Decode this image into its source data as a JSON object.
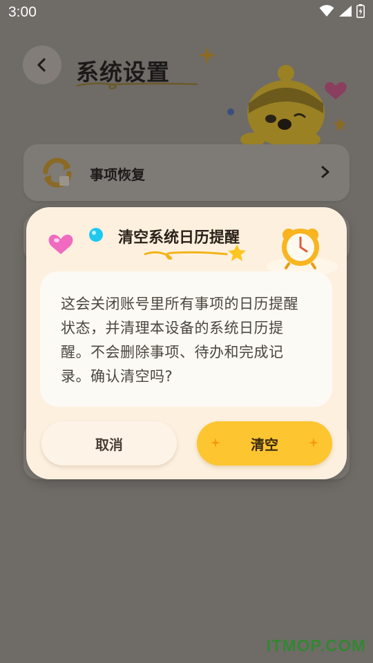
{
  "status_bar": {
    "time": "3:00"
  },
  "header": {
    "title": "系统设置"
  },
  "settings": {
    "items": [
      {
        "label": "事项恢复"
      }
    ]
  },
  "dialog": {
    "title": "清空系统日历提醒",
    "message": "这会关闭账号里所有事项的日历提醒状态，并清理本设备的系统日历提醒。不会删除事项、待办和完成记录。确认清空吗?",
    "cancel_label": "取消",
    "confirm_label": "清空"
  },
  "watermark": "ITMOP.COM",
  "colors": {
    "scrim": "#6f6b67",
    "dialog_bg": "#fdf0df",
    "body_bg": "#fcfaf5",
    "confirm_bg": "#fdc52f",
    "cancel_bg": "#fdf4e7"
  }
}
